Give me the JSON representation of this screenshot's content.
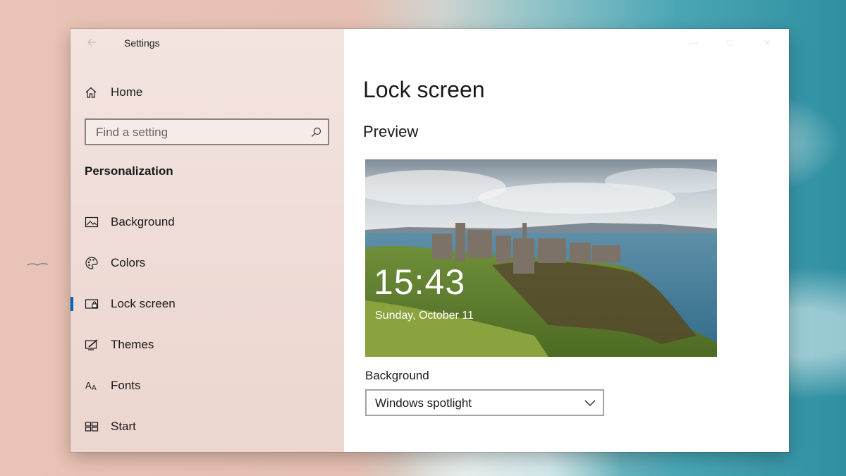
{
  "window": {
    "title": "Settings",
    "back_icon": "arrow-left-icon",
    "controls": [
      "minimize-icon",
      "maximize-icon",
      "close-icon"
    ]
  },
  "nav": {
    "home_label": "Home",
    "home_icon": "home-icon",
    "search": {
      "placeholder": "Find a setting",
      "icon": "search-icon"
    },
    "section_heading": "Personalization",
    "items": [
      {
        "label": "Background",
        "icon": "picture-icon",
        "selected": false
      },
      {
        "label": "Colors",
        "icon": "palette-icon",
        "selected": false
      },
      {
        "label": "Lock screen",
        "icon": "lock-screen-icon",
        "selected": true
      },
      {
        "label": "Themes",
        "icon": "themes-icon",
        "selected": false
      },
      {
        "label": "Fonts",
        "icon": "fonts-icon",
        "selected": false
      },
      {
        "label": "Start",
        "icon": "start-icon",
        "selected": false
      }
    ],
    "accent_color": "#0067c0"
  },
  "content": {
    "page_title": "Lock screen",
    "preview_heading": "Preview",
    "preview": {
      "time": "15:43",
      "date": "Sunday, October 11"
    },
    "background_label": "Background",
    "background_value": "Windows spotlight"
  }
}
